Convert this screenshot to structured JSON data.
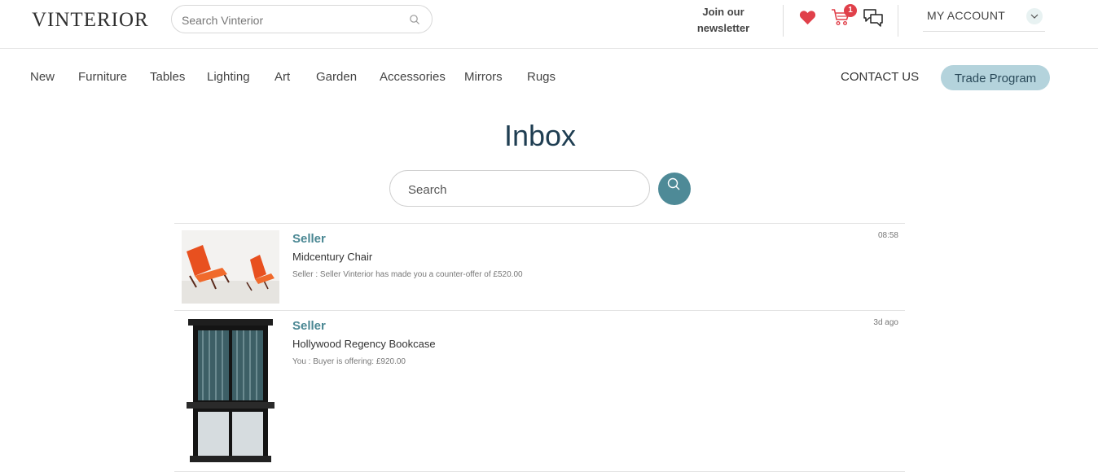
{
  "header": {
    "logo": "VINTERIOR",
    "search_placeholder": "Search Vinterior",
    "newsletter_line1": "Join our",
    "newsletter_line2": "newsletter",
    "cart_count": "1",
    "account_label": "MY ACCOUNT",
    "icons": [
      "search-icon",
      "heart-icon",
      "cart-icon",
      "chat-icon",
      "chevron-down-icon"
    ],
    "accent_color": "#e0404a"
  },
  "nav": {
    "items": [
      "New",
      "Furniture",
      "Tables",
      "Lighting",
      "Art",
      "Garden",
      "Accessories",
      "Mirrors",
      "Rugs"
    ],
    "contact_label": "CONTACT US",
    "trade_label": "Trade Program",
    "trade_color": "#b4d3dc"
  },
  "inbox": {
    "title": "Inbox",
    "search_placeholder": "Search",
    "button_color": "#4e8a97",
    "conversations": [
      {
        "sender": "Seller",
        "product": "Midcentury Chair",
        "preview": "Seller : Seller Vinterior has made you a counter-offer of £520.00",
        "time": "08:58"
      },
      {
        "sender": "Seller",
        "product": "Hollywood Regency Bookcase",
        "preview": "You : Buyer is offering: £920.00",
        "time": "3d ago"
      }
    ]
  }
}
